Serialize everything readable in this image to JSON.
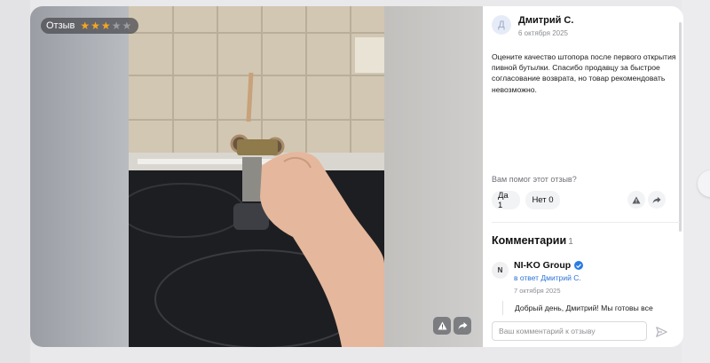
{
  "media": {
    "rating_label": "Отзыв",
    "rating_value": 3,
    "rating_max": 5,
    "icons": [
      "warning-icon",
      "share-arrow-icon"
    ]
  },
  "review": {
    "avatar_letter": "Д",
    "author": "Дмитрий С.",
    "date": "6 октября 2025",
    "text": "Оцените качество штопора после первого открытия пивной бутылки. Спасибо продавцу за быстрое согласование возврата, но товар рекомендовать невозможно.",
    "helpful_question": "Вам помог этот отзыв?",
    "yes_label": "Да 1",
    "no_label": "Нет 0"
  },
  "comments": {
    "title": "Комментарии",
    "count": "1",
    "items": [
      {
        "avatar_letter": "N",
        "author": "NI-KO Group",
        "reply_to": "в ответ Дмитрий С.",
        "date": "7 октября 2025",
        "text": "Добрый день, Дмитрий! Мы готовы все"
      }
    ],
    "input_placeholder": "Ваш комментарий к отзыву"
  },
  "colors": {
    "star": "#f5a623",
    "link": "#2a73d9",
    "verified": "#2a7be4"
  }
}
